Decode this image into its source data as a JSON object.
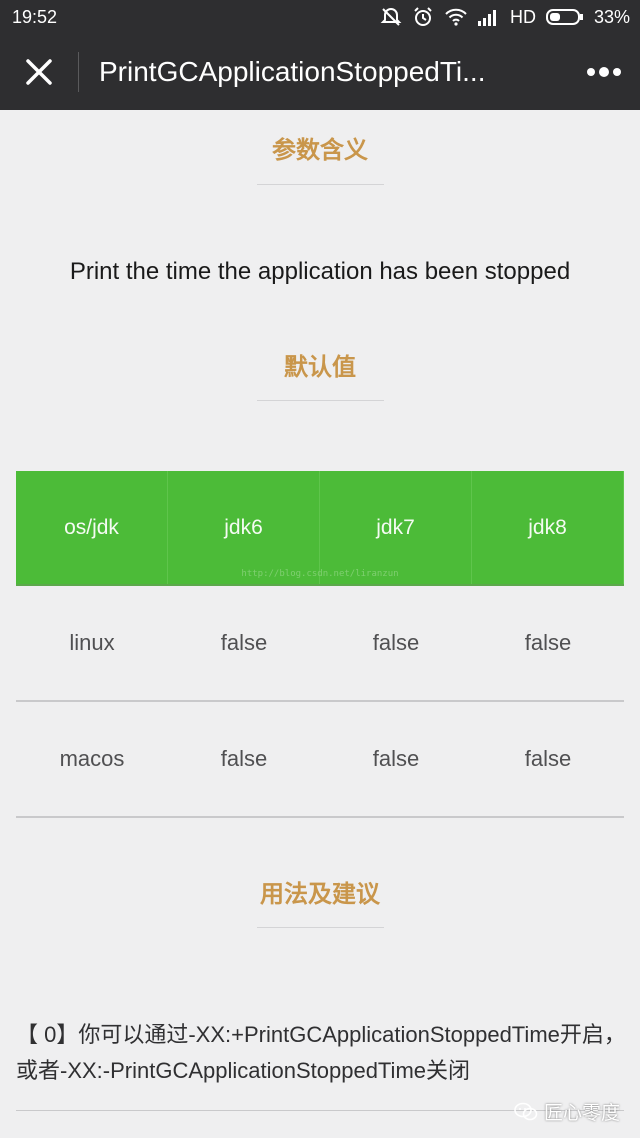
{
  "status_bar": {
    "time": "19:52",
    "network": "HD",
    "battery": "33%"
  },
  "app_bar": {
    "title": "PrintGCApplicationStoppedTi..."
  },
  "sections": {
    "meaning_title": "参数含义",
    "meaning_text": "Print the time the application has been stopped",
    "default_title": "默认值",
    "usage_title": "用法及建议"
  },
  "default_table": {
    "headers": [
      "os/jdk",
      "jdk6",
      "jdk7",
      "jdk8"
    ],
    "rows": [
      [
        "linux",
        "false",
        "false",
        "false"
      ],
      [
        "macos",
        "false",
        "false",
        "false"
      ]
    ],
    "watermark": "http://blog.csdn.net/liranzun"
  },
  "usage_text": "【 0】你可以通过-XX:+PrintGCApplicationStoppedTime开启，或者-XX:-PrintGCApplicationStoppedTime关闭",
  "brand": "匠心零度",
  "colors": {
    "bar_bg": "#2e2e30",
    "accent_title": "#c9964b",
    "table_header": "#4cbb38"
  },
  "icons": [
    "mute-icon",
    "alarm-icon",
    "wifi-icon",
    "signal-icon",
    "battery-icon",
    "close-icon",
    "more-icon",
    "wechat-icon"
  ]
}
